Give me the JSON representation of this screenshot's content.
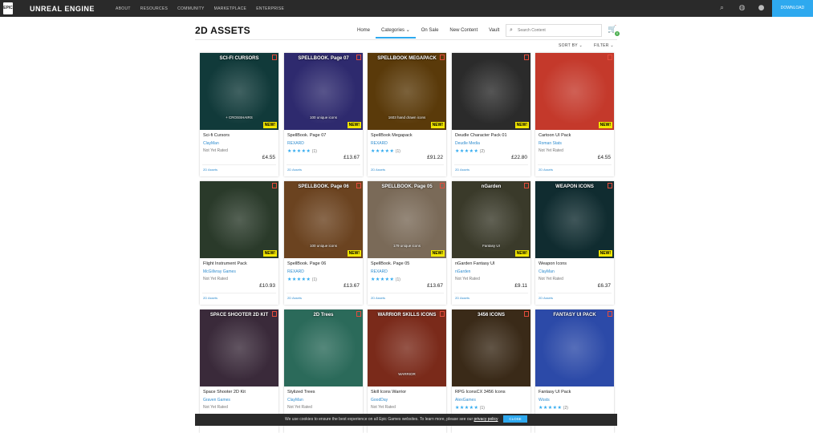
{
  "header": {
    "logo_text": "EPIC",
    "brand": "UNREAL ENGINE",
    "nav": [
      "ABOUT",
      "RESOURCES",
      "COMMUNITY",
      "MARKETPLACE",
      "ENTERPRISE"
    ],
    "download_label": "DOWNLOAD"
  },
  "page": {
    "title": "2D ASSETS"
  },
  "subnav": {
    "tabs": [
      "Home",
      "Categories ⌄",
      "On Sale",
      "New Content",
      "Vault"
    ],
    "search_placeholder": "Search Content",
    "cart_count": "0"
  },
  "controls": {
    "sort_label": "SORT BY ⌄",
    "filter_label": "FILTER ⌄"
  },
  "products": [
    {
      "title": "Sci-fi Cursors",
      "seller": "ClayMan",
      "rating": "Not Yet Rated",
      "price": "£4.55",
      "category": "2D Assets",
      "thumb_text": "SCI-FI CURSORS",
      "thumb_sub": "+ CROSSHAIRS",
      "badge": "NEW!"
    },
    {
      "title": "SpellBook. Page 07",
      "seller": "REXARD",
      "rating": "★★★★★ (1)",
      "price": "£13.67",
      "category": "2D Assets",
      "thumb_text": "SPELLBOOK. Page 07",
      "thumb_sub": "100 unique icons",
      "badge": "NEW!"
    },
    {
      "title": "SpellBook Megapack",
      "seller": "REXARD",
      "rating": "★★★★★ (1)",
      "price": "£91.22",
      "category": "2D Assets",
      "thumb_text": "SPELLBOOK MEGAPACK",
      "thumb_sub": "1603 hand drawn icons",
      "badge": "NEW!"
    },
    {
      "title": "Deudle Character Pack 01",
      "seller": "Deudle Media",
      "rating": "★★★★★ (2)",
      "price": "£22.80",
      "category": "2D Assets",
      "thumb_text": "",
      "thumb_sub": "",
      "badge": "NEW!"
    },
    {
      "title": "Cartoon UI Pack",
      "seller": "Roman Stats",
      "rating": "Not Yet Rated",
      "price": "£4.55",
      "category": "2D Assets",
      "thumb_text": "",
      "thumb_sub": "",
      "badge": "NEW!"
    },
    {
      "title": "Flight Instrument Pack",
      "seller": "McGillvray Games",
      "rating": "Not Yet Rated",
      "price": "£10.93",
      "category": "2D Assets",
      "thumb_text": "",
      "thumb_sub": "",
      "badge": "NEW!"
    },
    {
      "title": "SpellBook. Page 06",
      "seller": "REXARD",
      "rating": "★★★★★ (1)",
      "price": "£13.67",
      "category": "2D Assets",
      "thumb_text": "SPELLBOOK. Page 06",
      "thumb_sub": "100 unique icons",
      "badge": "NEW!"
    },
    {
      "title": "SpellBook. Page 05",
      "seller": "REXARD",
      "rating": "★★★★★ (1)",
      "price": "£13.67",
      "category": "2D Assets",
      "thumb_text": "SPELLBOOK. Page 05",
      "thumb_sub": "179 unique icons",
      "badge": "NEW!"
    },
    {
      "title": "nGarden Fantasy UI",
      "seller": "nGarden",
      "rating": "Not Yet Rated",
      "price": "£9.11",
      "category": "2D Assets",
      "thumb_text": "nGarden",
      "thumb_sub": "Fantasy UI",
      "badge": "NEW!"
    },
    {
      "title": "Weapon Icons",
      "seller": "ClayMan",
      "rating": "Not Yet Rated",
      "price": "£6.37",
      "category": "2D Assets",
      "thumb_text": "WEAPON ICONS",
      "thumb_sub": "",
      "badge": "NEW!"
    },
    {
      "title": "Space Shooter 2D Kit",
      "seller": "Graven Games",
      "rating": "Not Yet Rated",
      "price": "",
      "category": "",
      "thumb_text": "SPACE SHOOTER 2D KIT",
      "thumb_sub": "",
      "badge": ""
    },
    {
      "title": "Stylized Trees",
      "seller": "ClayMan",
      "rating": "Not Yet Rated",
      "price": "",
      "category": "",
      "thumb_text": "2D Trees",
      "thumb_sub": "",
      "badge": ""
    },
    {
      "title": "Skill Icons Warrior",
      "seller": "GoodDay",
      "rating": "Not Yet Rated",
      "price": "",
      "category": "",
      "thumb_text": "WARRIOR SKILLS ICONS",
      "thumb_sub": "WARRIOR",
      "badge": ""
    },
    {
      "title": "RPG IconsCX 3456 Icons",
      "seller": "AlexGames",
      "rating": "★★★★★ (1)",
      "price": "",
      "category": "",
      "thumb_text": "3456 ICONS",
      "thumb_sub": "",
      "badge": ""
    },
    {
      "title": "Fantasy UI Pack",
      "seller": "Wosts",
      "rating": "★★★★★ (2)",
      "price": "",
      "category": "",
      "thumb_text": "FANTASY UI PACK",
      "thumb_sub": "",
      "badge": ""
    }
  ],
  "cookie": {
    "text": "We use cookies to ensure the best experience on all Epic Games websites. To learn more, please see our",
    "link": "privacy policy",
    "button": "CLOSE"
  },
  "colors": {
    "topbar": "#2a2a2a",
    "accent": "#2ea9ef",
    "new_badge": "#f2e600",
    "thumbs": [
      "#113a3a",
      "#2e2a6e",
      "#5a3a0a",
      "#2b2b2b",
      "#c4392b",
      "#2a3a2a",
      "#6b4320",
      "#7a6a58",
      "#3a3a2a",
      "#102c30",
      "#3a2a3a",
      "#2b6a5a",
      "#7a2a1a",
      "#3a2a18",
      "#2c4aa8"
    ]
  }
}
